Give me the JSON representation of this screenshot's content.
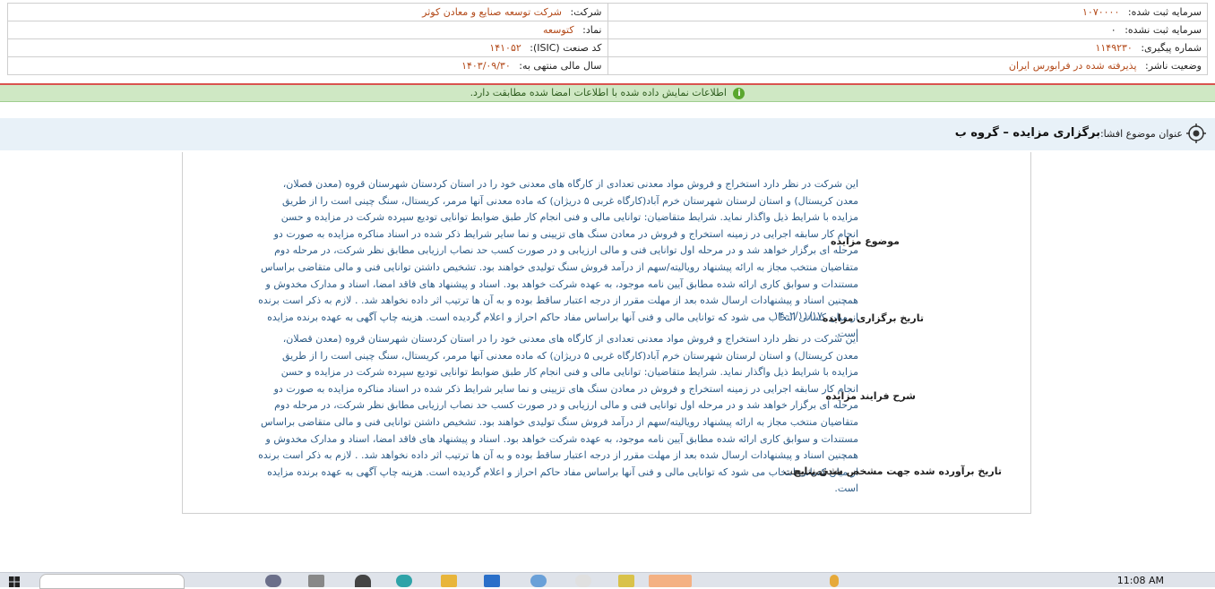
{
  "company_info": {
    "company_label": "شرکت:",
    "company_value": "شرکت توسعه صنایع و معادن کوثر",
    "registered_capital_label": "سرمایه ثبت شده:",
    "registered_capital_value": "۱۰۷۰۰۰۰",
    "symbol_label": "نماد:",
    "symbol_value": "کتوسعه",
    "unregistered_capital_label": "سرمایه ثبت نشده:",
    "unregistered_capital_value": "۰",
    "isic_label": "کد صنعت (ISIC):",
    "isic_value": "۱۴۱۰۵۲",
    "tracking_label": "شماره پیگیری:",
    "tracking_value": "۱۱۴۹۲۳۰",
    "fiscal_label": "سال مالی منتهی به:",
    "fiscal_value": "۱۴۰۳/۰۹/۳۰",
    "publisher_status_label": "وضعیت ناشر:",
    "publisher_status_value": "پذیرفته شده در فرابورس ایران"
  },
  "notice": {
    "text": "اطلاعات نمایش داده شده با اطلاعات امضا شده مطابقت دارد."
  },
  "subject": {
    "label": "عنوان موضوع افشا:",
    "title": "برگزاری مزایده – گروه ب"
  },
  "details": {
    "auction_subject_label": "موضوع مزایده",
    "auction_subject_text": "این شرکت در نظر دارد استخراج و فروش مواد معدنی تعدادی از کارگاه های معدنی خود را در استان کردستان شهرستان قروه (معدن قصلان، معدن کریستال) و استان لرستان شهرستان خرم آباد(کارگاه غربی ۵ دریژان) که ماده معدنی آنها مرمر، کریستال، سنگ چینی است را از طریق مزایده با شرایط ذیل واگذار نماید. شرایط متقاضیان: توانایی مالی و فنی انجام کار طبق ضوابط توانایی تودیع سپرده شرکت در مزایده و حسن انجام کار سابقه اجرایی در زمینه استخراج و فروش در معادن سنگ های تزیینی و نما سایر شرایط ذکر شده در اسناد مناکره مزایده به صورت دو مرحله ای برگزار خواهد شد و در مرحله اول توانایی فنی و مالی ارزیابی و در صورت کسب حد نصاب ارزیابی مطابق نظر شرکت، در مرحله دوم متقاضیان منتخب مجاز به ارائه پیشنهاد رویالیته/سهم از درآمد فروش سنگ تولیدی خواهند بود. تشخیص داشتن توانایی فنی و مالی متقاضی براساس مستندات و سوابق کاری ارائه شده مطابق آیین نامه موجود، به عهده شرکت خواهد بود. اسناد و پیشنهاد های فاقد امضا، اسناد و مدارک مخدوش و همچنین اسناد و پیشنهادات ارسال شده بعد از مهلت مقرر از درجه اعتبار ساقط بوده و به آن ها ترتیب اثر داده نخواهد شد. . لازم به ذکر است برنده از میان کسانی انتخاب می شود که توانایی مالی و فنی آنها براساس مفاد حاکم احراز و اعلام گردیده است. هزینه چاپ آگهی به عهده برنده مزایده است.",
    "auction_date_label": "تاریخ برگزاری مزایده",
    "auction_date_value": "۱۴۰۲/۱۱/۱۷",
    "process_label": "شرح فرایند مزایده",
    "process_text": "این شرکت در نظر دارد استخراج و فروش مواد معدنی تعدادی از کارگاه های معدنی خود را در استان کردستان شهرستان قروه (معدن قصلان، معدن کریستال) و استان لرستان شهرستان خرم آباد(کارگاه غربی ۵ دریژان) که ماده معدنی آنها مرمر، کریستال، سنگ چینی است را از طریق مزایده با شرایط ذیل واگذار نماید. شرایط متقاضیان: توانایی مالی و فنی انجام کار طبق ضوابط توانایی تودیع سپرده شرکت در مزایده و حسن انجام کار سابقه اجرایی در زمینه استخراج و فروش در معادن سنگ های تزیینی و نما سایر شرایط ذکر شده در اسناد مناکره مزایده به صورت دو مرحله ای برگزار خواهد شد و در مرحله اول توانایی فنی و مالی ارزیابی و در صورت کسب حد نصاب ارزیابی مطابق نظر شرکت، در مرحله دوم متقاضیان منتخب مجاز به ارائه پیشنهاد رویالیته/سهم از درآمد فروش سنگ تولیدی خواهند بود. تشخیص داشتن توانایی فنی و مالی متقاضی براساس مستندات و سوابق کاری ارائه شده مطابق آیین نامه موجود، به عهده شرکت خواهد بود. اسناد و پیشنهاد های فاقد امضا، اسناد و مدارک مخدوش و همچنین اسناد و پیشنهادات ارسال شده بعد از مهلت مقرر از درجه اعتبار ساقط بوده و به آن ها ترتیب اثر داده نخواهد شد. . لازم به ذکر است برنده از میان کسانی انتخاب می شود که توانایی مالی و فنی آنها براساس مفاد حاکم احراز و اعلام گردیده است. هزینه چاپ آگهی به عهده برنده مزایده است.",
    "result_date_label": "تاریخ برآورده شده جهت مشخص شدن نتایج",
    "result_date_value": "مشخص نیست"
  },
  "taskbar": {
    "clock": "11:08 AM"
  }
}
